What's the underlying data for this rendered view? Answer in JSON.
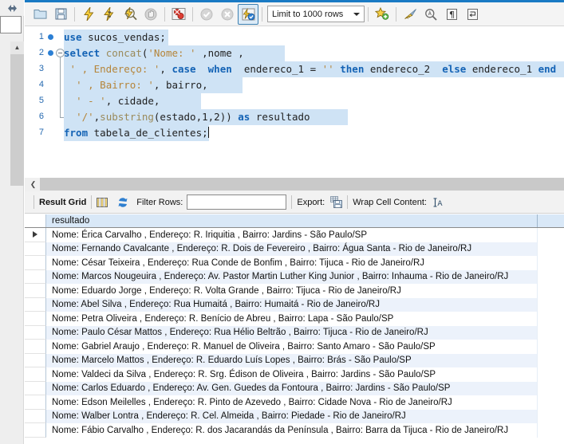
{
  "window": {
    "accent_color": "#1a7ac4",
    "app": "MySQL Workbench SQL Editor"
  },
  "left_strip": {
    "glyph": "db-connection-icon",
    "scroll_up_glyph": "▲"
  },
  "toolbar": {
    "buttons": [
      {
        "name": "open-sql-script-button",
        "icon": "folder-icon",
        "title": "Open a SQL script file"
      },
      {
        "name": "save-sql-script-button",
        "icon": "save-icon",
        "title": "Save SQL script to file"
      },
      {
        "name": "execute-statement-button",
        "icon": "lightning-icon",
        "title": "Execute the selected portion of the script"
      },
      {
        "name": "execute-current-statement-button",
        "icon": "lightning-cursor-icon",
        "title": "Execute the statement under the keyboard cursor"
      },
      {
        "name": "explain-statement-button",
        "icon": "lightning-magnifier-icon",
        "title": "Execute the EXPLAIN command"
      },
      {
        "name": "stop-statement-button",
        "icon": "stop-hand-icon",
        "title": "Stop the statement being executed"
      },
      {
        "name": "toggle-stop-on-error-button",
        "icon": "stop-on-error-icon",
        "title": "Toggle whether execution should stop on errors"
      },
      {
        "name": "commit-button",
        "icon": "commit-check-icon",
        "title": "Commit"
      },
      {
        "name": "rollback-button",
        "icon": "rollback-cross-icon",
        "title": "Rollback"
      },
      {
        "name": "toggle-autocommit-button",
        "icon": "autocommit-icon",
        "title": "Toggle autocommit mode",
        "active": true
      }
    ],
    "limit_label": "Limit to 1000 rows",
    "right_buttons": [
      {
        "name": "save-snippet-button",
        "icon": "star-plus-icon",
        "title": "Save current statement to snippets"
      },
      {
        "name": "beautify-query-button",
        "icon": "broom-icon",
        "title": "Beautify/reformat the SQL script"
      },
      {
        "name": "find-button",
        "icon": "magnifier-icon",
        "title": "Show the Find panel"
      },
      {
        "name": "toggle-invisible-chars-button",
        "icon": "pilcrow-icon",
        "title": "Toggle invisible characters"
      },
      {
        "name": "toggle-wrapping-button",
        "icon": "wrap-lines-icon",
        "title": "Toggle wrapping of long lines"
      }
    ]
  },
  "editor": {
    "lines": [
      {
        "number": "1",
        "breakpoint": true,
        "fold": "none",
        "tokens": [
          {
            "t": "use ",
            "c": "kw"
          },
          {
            "t": "sucos_vendas;",
            "c": "pl"
          }
        ],
        "highlight_width": 131
      },
      {
        "number": "2",
        "breakpoint": true,
        "fold": "start",
        "tokens": [
          {
            "t": "select ",
            "c": "kw"
          },
          {
            "t": "concat",
            "c": "fn"
          },
          {
            "t": "(",
            "c": "pl"
          },
          {
            "t": "'Nome: '",
            "c": "str"
          },
          {
            "t": " ,nome ,",
            "c": "pl"
          }
        ],
        "highlight_width": 277
      },
      {
        "number": "3",
        "breakpoint": false,
        "fold": "mid",
        "tokens": [
          {
            "t": " ",
            "c": "pl"
          },
          {
            "t": "' , Endereço: '",
            "c": "str"
          },
          {
            "t": ", ",
            "c": "pl"
          },
          {
            "t": "case",
            "c": "kw"
          },
          {
            "t": "  ",
            "c": "pl"
          },
          {
            "t": "when",
            "c": "kw"
          },
          {
            "t": "  endereco_1 = ",
            "c": "pl"
          },
          {
            "t": "''",
            "c": "str"
          },
          {
            "t": " ",
            "c": "pl"
          },
          {
            "t": "then",
            "c": "kw"
          },
          {
            "t": " endereco_2  ",
            "c": "pl"
          },
          {
            "t": "else",
            "c": "kw"
          },
          {
            "t": " endereco_1 ",
            "c": "pl"
          },
          {
            "t": "end",
            "c": "kw"
          },
          {
            "t": " ,",
            "c": "pl"
          }
        ],
        "highlight_width": 656
      },
      {
        "number": "4",
        "breakpoint": false,
        "fold": "mid",
        "tokens": [
          {
            "t": "  ",
            "c": "pl"
          },
          {
            "t": "' , Bairro: '",
            "c": "str"
          },
          {
            "t": ", bairro,",
            "c": "pl"
          }
        ],
        "highlight_width": 224
      },
      {
        "number": "5",
        "breakpoint": false,
        "fold": "mid",
        "tokens": [
          {
            "t": "  ",
            "c": "pl"
          },
          {
            "t": "' - '",
            "c": "str"
          },
          {
            "t": ", cidade,",
            "c": "pl"
          }
        ],
        "highlight_width": 172
      },
      {
        "number": "6",
        "breakpoint": false,
        "fold": "end",
        "tokens": [
          {
            "t": "  ",
            "c": "pl"
          },
          {
            "t": "'/'",
            "c": "str"
          },
          {
            "t": ",",
            "c": "pl"
          },
          {
            "t": "substring",
            "c": "fn"
          },
          {
            "t": "(estado,1,2)) ",
            "c": "pl"
          },
          {
            "t": "as",
            "c": "kw"
          },
          {
            "t": " resultado",
            "c": "pl"
          }
        ],
        "highlight_width": 356
      },
      {
        "number": "7",
        "breakpoint": false,
        "fold": "none",
        "tokens": [
          {
            "t": "from",
            "c": "kw"
          },
          {
            "t": " tabela_de_clientes;",
            "c": "pl"
          }
        ],
        "highlight_width": 172,
        "cursor": true
      }
    ]
  },
  "grid_toolbar": {
    "result_grid_label": "Result Grid",
    "grid_view_icon": "grid-view-icon",
    "refresh_icon": "refresh-icon",
    "filter_label": "Filter Rows:",
    "filter_value": "",
    "filter_placeholder": "",
    "export_label": "Export:",
    "export_icon": "export-icon",
    "wrap_label": "Wrap Cell Content:",
    "wrap_icon": "wrap-cell-icon"
  },
  "results": {
    "columns": [
      "resultado"
    ],
    "selected_row_index": 0,
    "rows": [
      "Nome: Érica Carvalho , Endereço: R. Iriquitia , Bairro: Jardins - São Paulo/SP",
      "Nome: Fernando Cavalcante , Endereço: R. Dois de Fevereiro , Bairro: Água Santa - Rio de Janeiro/RJ",
      "Nome: César Teixeira , Endereço: Rua Conde de Bonfim , Bairro: Tijuca - Rio de Janeiro/RJ",
      "Nome: Marcos Nougeuira , Endereço: Av. Pastor Martin Luther King Junior , Bairro: Inhauma - Rio de Janeiro/RJ",
      "Nome: Eduardo Jorge , Endereço: R. Volta Grande , Bairro: Tijuca - Rio de Janeiro/RJ",
      "Nome: Abel Silva  , Endereço: Rua Humaitá , Bairro: Humaitá - Rio de Janeiro/RJ",
      "Nome: Petra Oliveira , Endereço: R. Benício de Abreu , Bairro: Lapa - São Paulo/SP",
      "Nome: Paulo César Mattos , Endereço: Rua Hélio Beltrão , Bairro: Tijuca - Rio de Janeiro/RJ",
      "Nome: Gabriel Araujo , Endereço: R. Manuel de Oliveira , Bairro: Santo Amaro - São Paulo/SP",
      "Nome: Marcelo Mattos , Endereço: R. Eduardo Luís Lopes , Bairro: Brás - São Paulo/SP",
      "Nome: Valdeci da Silva , Endereço: R. Srg. Édison de Oliveira , Bairro: Jardins - São Paulo/SP",
      "Nome: Carlos Eduardo , Endereço: Av. Gen. Guedes da Fontoura , Bairro: Jardins - São Paulo/SP",
      "Nome: Edson Meilelles , Endereço: R. Pinto de Azevedo , Bairro: Cidade Nova - Rio de Janeiro/RJ",
      "Nome: Walber Lontra , Endereço: R. Cel. Almeida , Bairro: Piedade - Rio de Janeiro/RJ",
      "Nome: Fábio Carvalho , Endereço: R. dos Jacarandás da Península , Bairro: Barra da Tijuca - Rio de Janeiro/RJ"
    ]
  }
}
